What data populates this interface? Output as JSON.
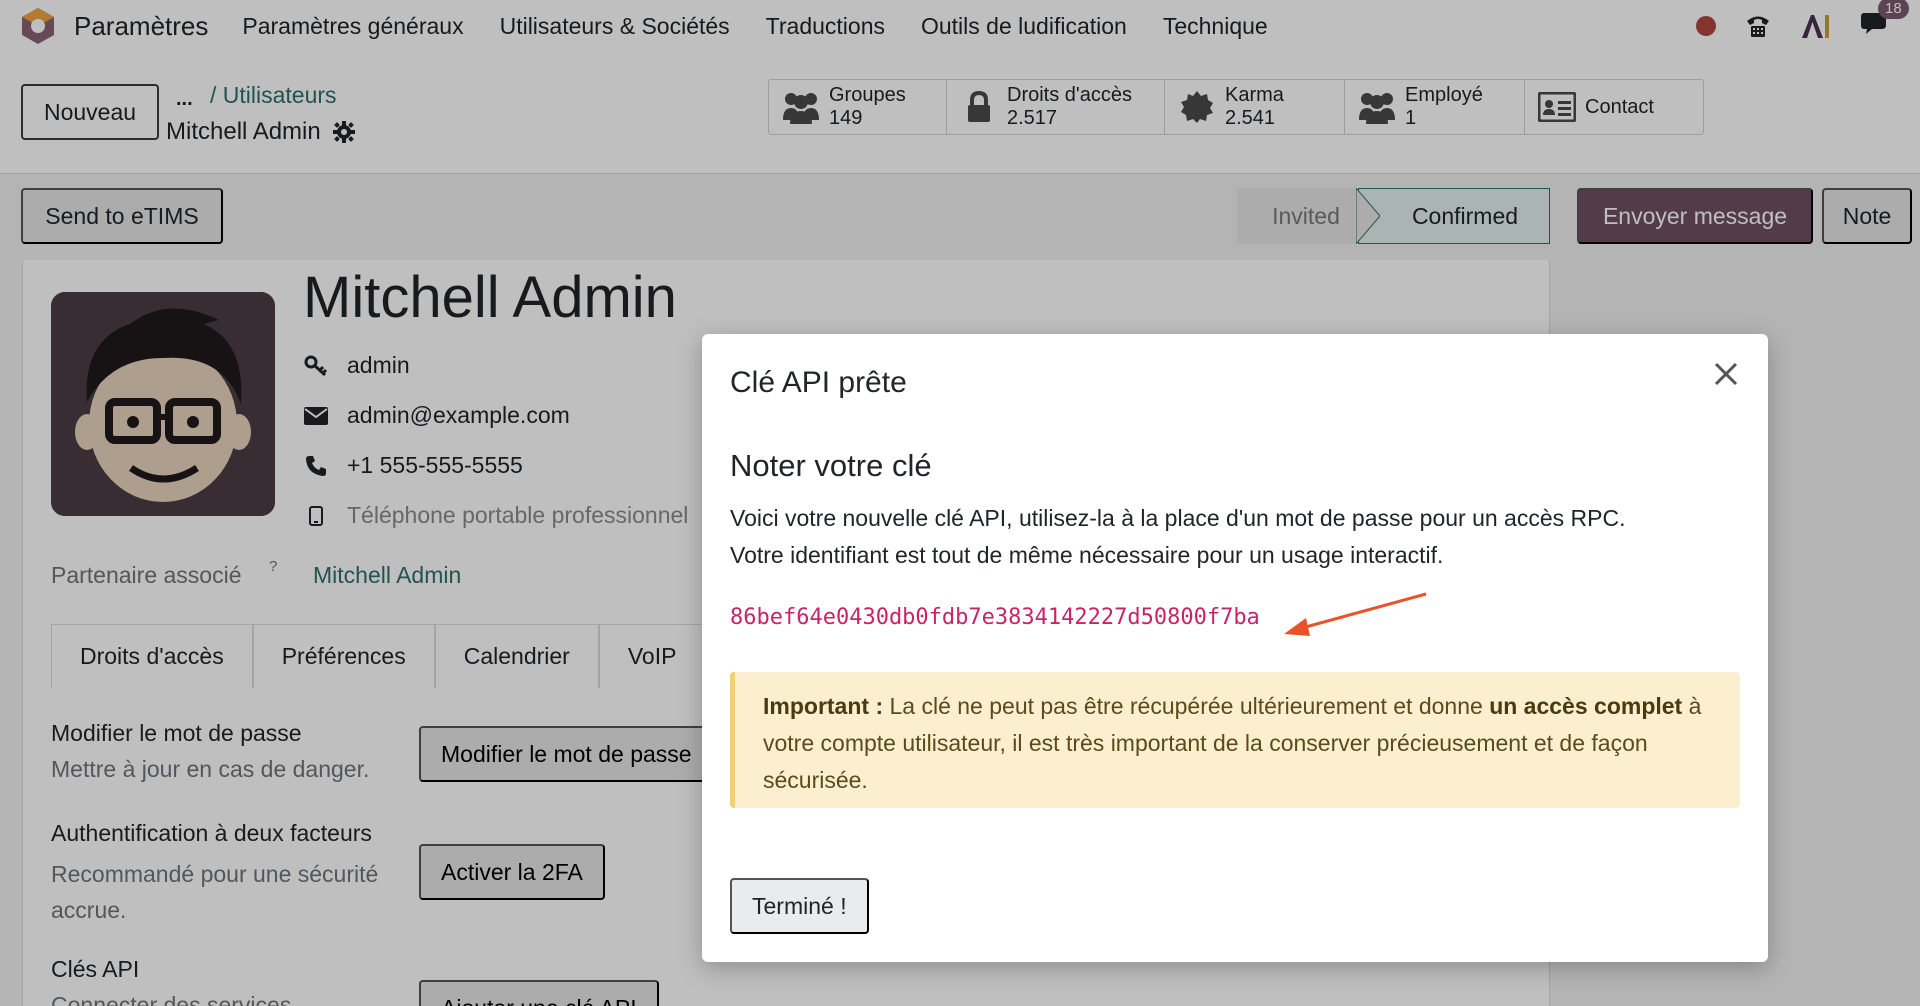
{
  "navbar": {
    "app_name": "Paramètres",
    "menu": [
      "Paramètres généraux",
      "Utilisateurs & Sociétés",
      "Traductions",
      "Outils de ludification",
      "Technique"
    ],
    "icons": [
      "status-dot-icon",
      "phone-icon",
      "ai-icon",
      "chat-icon"
    ],
    "chat_badge": "18"
  },
  "control_panel": {
    "new_button": "Nouveau",
    "breadcrumb_dots": "...",
    "breadcrumb_link": "/ Utilisateurs",
    "breadcrumb_current": "Mitchell Admin",
    "stats": [
      {
        "icon": "users-icon",
        "label": "Groupes",
        "value": "149"
      },
      {
        "icon": "lock-icon",
        "label": "Droits d'accès",
        "value": "2.517"
      },
      {
        "icon": "badge-icon",
        "label": "Karma",
        "value": "2.541"
      },
      {
        "icon": "users-icon",
        "label": "Employé",
        "value": "1"
      },
      {
        "icon": "contact-card-icon",
        "label": "Contact",
        "value": ""
      }
    ]
  },
  "status_row": {
    "send_etims": "Send to eTIMS",
    "stages": [
      "Invited",
      "Confirmed"
    ],
    "active_stage": "Confirmed",
    "send_message": "Envoyer message",
    "note": "Note"
  },
  "form": {
    "name": "Mitchell Admin",
    "login": "admin",
    "email": "admin@example.com",
    "phone": "+1 555-555-5555",
    "mobile_placeholder": "Téléphone portable professionnel",
    "partner_label": "Partenaire associé",
    "partner_help": "?",
    "partner_value": "Mitchell Admin",
    "tabs": [
      "Droits d'accès",
      "Préférences",
      "Calendrier",
      "VoIP"
    ],
    "sections": [
      {
        "title": "Modifier le mot de passe",
        "subtitle": "Mettre à jour en cas de danger.",
        "button": "Modifier le mot de passe"
      },
      {
        "title": "Authentification à deux facteurs",
        "subtitle": "Recommandé pour une sécurité accrue.",
        "button": "Activer la 2FA"
      },
      {
        "title": "Clés API",
        "subtitle": "Connecter des services",
        "button": "Ajouter une clé API"
      }
    ]
  },
  "modal": {
    "title": "Clé API prête",
    "heading": "Noter votre clé",
    "description_line1": "Voici votre nouvelle clé API, utilisez-la à la place d'un mot de passe pour un accès RPC.",
    "description_line2": "Votre identifiant est tout de même nécessaire pour un usage interactif.",
    "api_key": "86bef64e0430db0fdb7e3834142227d50800f7ba",
    "alert_strong1": "Important :",
    "alert_text1": " La clé ne peut pas être récupérée ultérieurement et donne ",
    "alert_strong2": "un accès complet",
    "alert_text2": " à votre compte utilisateur, il est très important de la conserver précieusement et de façon sécurisée.",
    "done_button": "Terminé !"
  },
  "colors": {
    "accent": "#6f4f63",
    "link": "#2f6f6b",
    "api_key": "#c7246a",
    "alert_bg": "#fcefcf",
    "arrow": "#e8532b"
  }
}
